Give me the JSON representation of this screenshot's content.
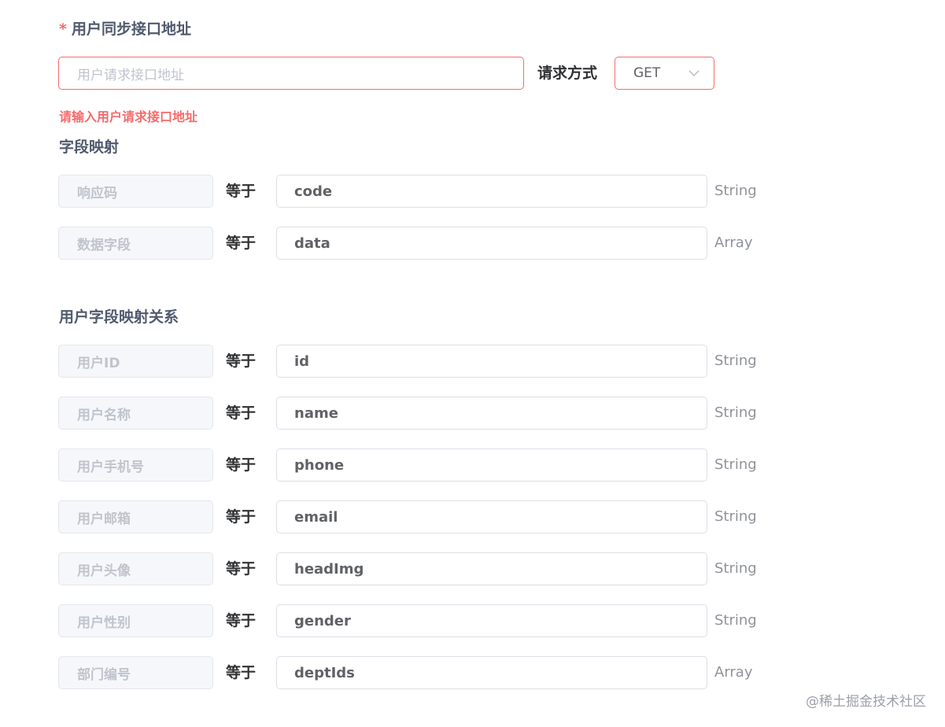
{
  "sync": {
    "required_mark": "*",
    "title": "用户同步接口地址",
    "url_placeholder": "用户请求接口地址",
    "method_label": "请求方式",
    "method_value": "GET",
    "error": "请输入用户请求接口地址"
  },
  "field_mapping": {
    "title": "字段映射",
    "rows": [
      {
        "key": "响应码",
        "eq": "等于",
        "value": "code",
        "type": "String"
      },
      {
        "key": "数据字段",
        "eq": "等于",
        "value": "data",
        "type": "Array"
      }
    ]
  },
  "user_mapping": {
    "title": "用户字段映射关系",
    "rows": [
      {
        "key": "用户ID",
        "eq": "等于",
        "value": "id",
        "type": "String"
      },
      {
        "key": "用户名称",
        "eq": "等于",
        "value": "name",
        "type": "String"
      },
      {
        "key": "用户手机号",
        "eq": "等于",
        "value": "phone",
        "type": "String"
      },
      {
        "key": "用户邮箱",
        "eq": "等于",
        "value": "email",
        "type": "String"
      },
      {
        "key": "用户头像",
        "eq": "等于",
        "value": "headImg",
        "type": "String"
      },
      {
        "key": "用户性别",
        "eq": "等于",
        "value": "gender",
        "type": "String"
      },
      {
        "key": "部门编号",
        "eq": "等于",
        "value": "deptIds",
        "type": "Array"
      }
    ]
  },
  "watermark": "@稀土掘金技术社区"
}
